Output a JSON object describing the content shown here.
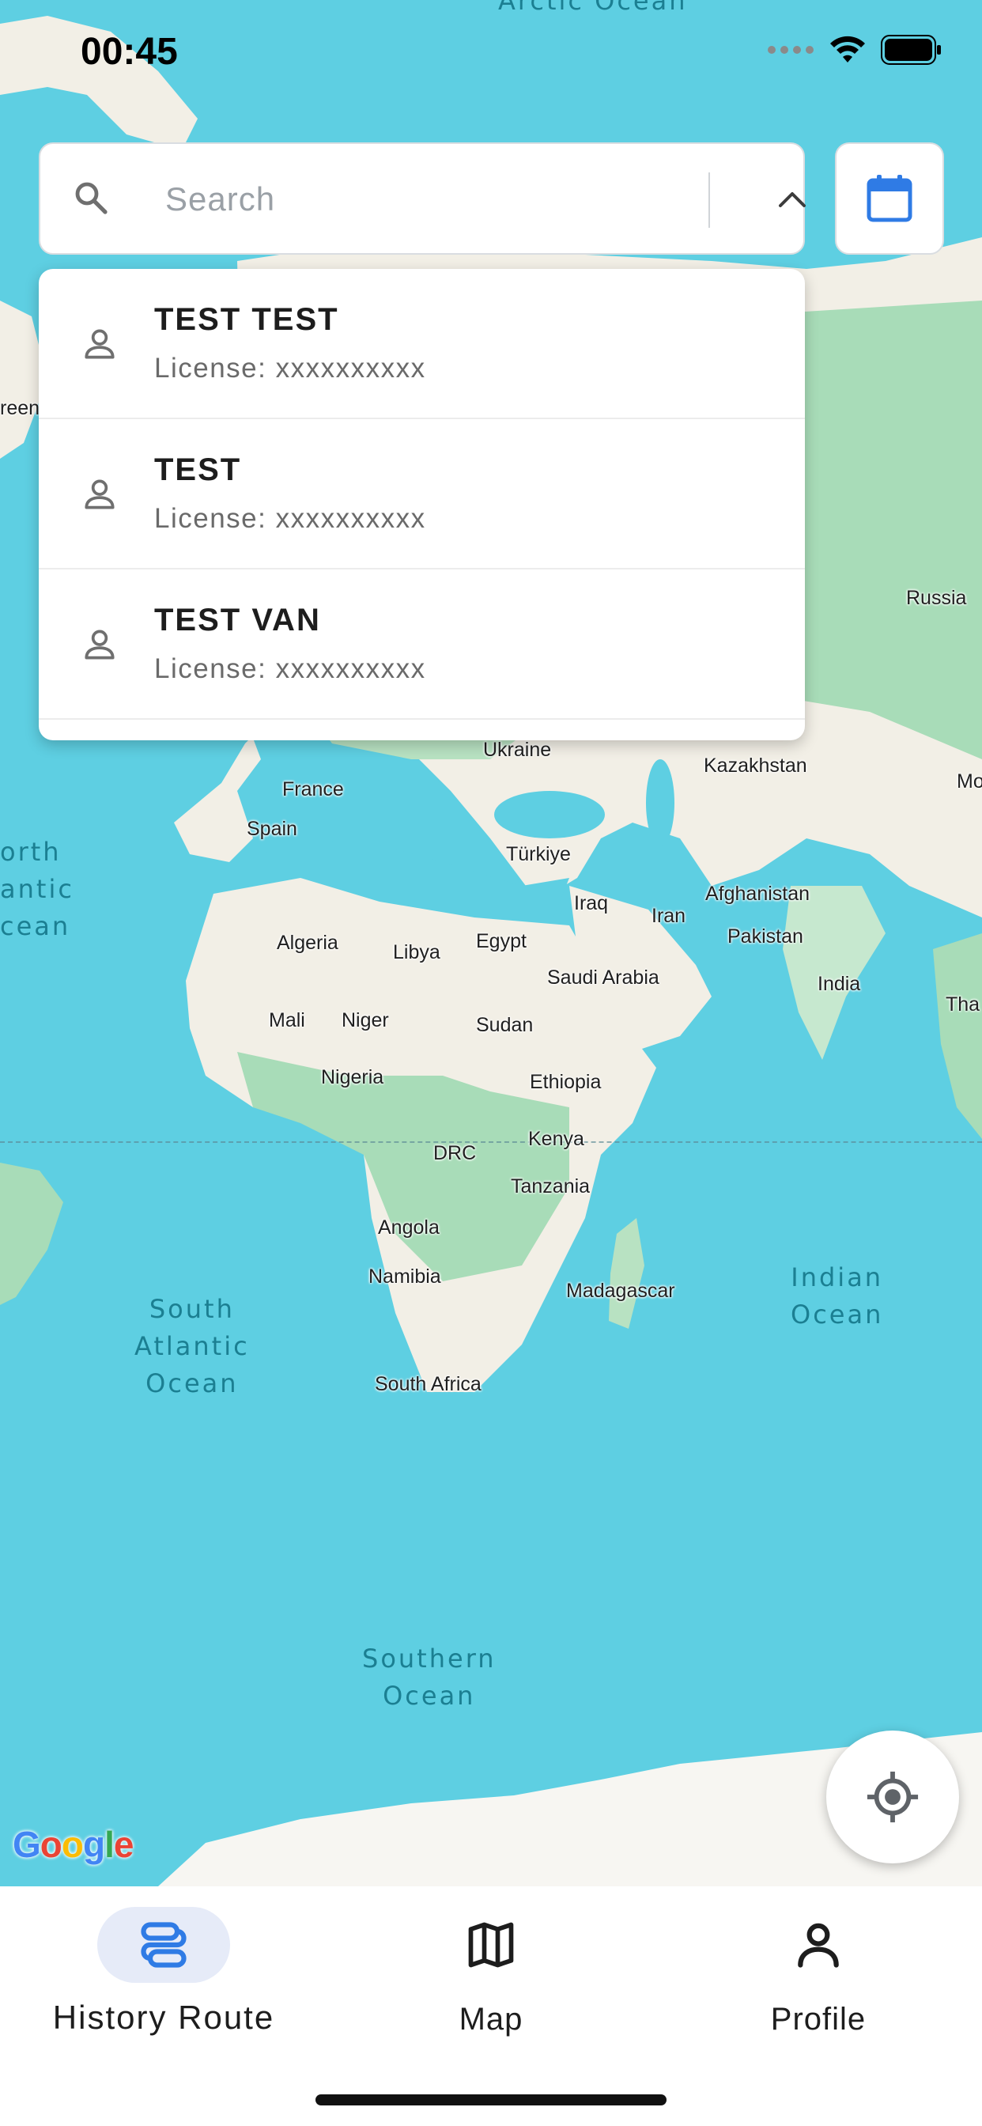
{
  "status_bar": {
    "time": "00:45"
  },
  "search": {
    "placeholder": "Search",
    "value": ""
  },
  "dropdown": {
    "items": [
      {
        "name": "TEST TEST",
        "license": "License:  xxxxxxxxxx"
      },
      {
        "name": "TEST",
        "license": "License: xxxxxxxxxx"
      },
      {
        "name": "TEST VAN",
        "license": "License: xxxxxxxxxx"
      }
    ]
  },
  "map": {
    "countries": {
      "russia": "Russia",
      "ukraine": "Ukraine",
      "kazakhstan": "Kazakhstan",
      "mo": "Mo",
      "france": "France",
      "spain": "Spain",
      "turkiye": "Türkiye",
      "iraq": "Iraq",
      "iran": "Iran",
      "afghanistan": "Afghanistan",
      "pakistan": "Pakistan",
      "india": "India",
      "tha": "Tha",
      "algeria": "Algeria",
      "libya": "Libya",
      "egypt": "Egypt",
      "saudi_arabia": "Saudi Arabia",
      "mali": "Mali",
      "niger": "Niger",
      "sudan": "Sudan",
      "nigeria": "Nigeria",
      "ethiopia": "Ethiopia",
      "kenya": "Kenya",
      "drc": "DRC",
      "tanzania": "Tanzania",
      "angola": "Angola",
      "namibia": "Namibia",
      "madagascar": "Madagascar",
      "south_africa": "South Africa",
      "reen": "reen"
    },
    "oceans": {
      "arctic": "Arctic Ocean",
      "north_atlantic": "orth\nantic\ncean",
      "south_atlantic": "South\nAtlantic\nOcean",
      "indian": "Indian\nOcean",
      "southern": "Southern\nOcean"
    },
    "attribution": "Google"
  },
  "nav": {
    "items": [
      {
        "label": "History Route",
        "active": true
      },
      {
        "label": "Map",
        "active": false
      },
      {
        "label": "Profile",
        "active": false
      }
    ]
  },
  "colors": {
    "ocean": "#5ecfe2",
    "land": "#f2efe6",
    "forest": "#a8dcb8",
    "accent": "#2f7be5",
    "nav_pill": "#e6ebf8"
  },
  "icons": {
    "search": "search-icon",
    "chevron": "chevron-up-icon",
    "calendar": "calendar-icon",
    "person": "person-icon",
    "locate": "my-location-icon",
    "route": "route-icon",
    "map": "map-icon",
    "profile": "profile-icon"
  }
}
